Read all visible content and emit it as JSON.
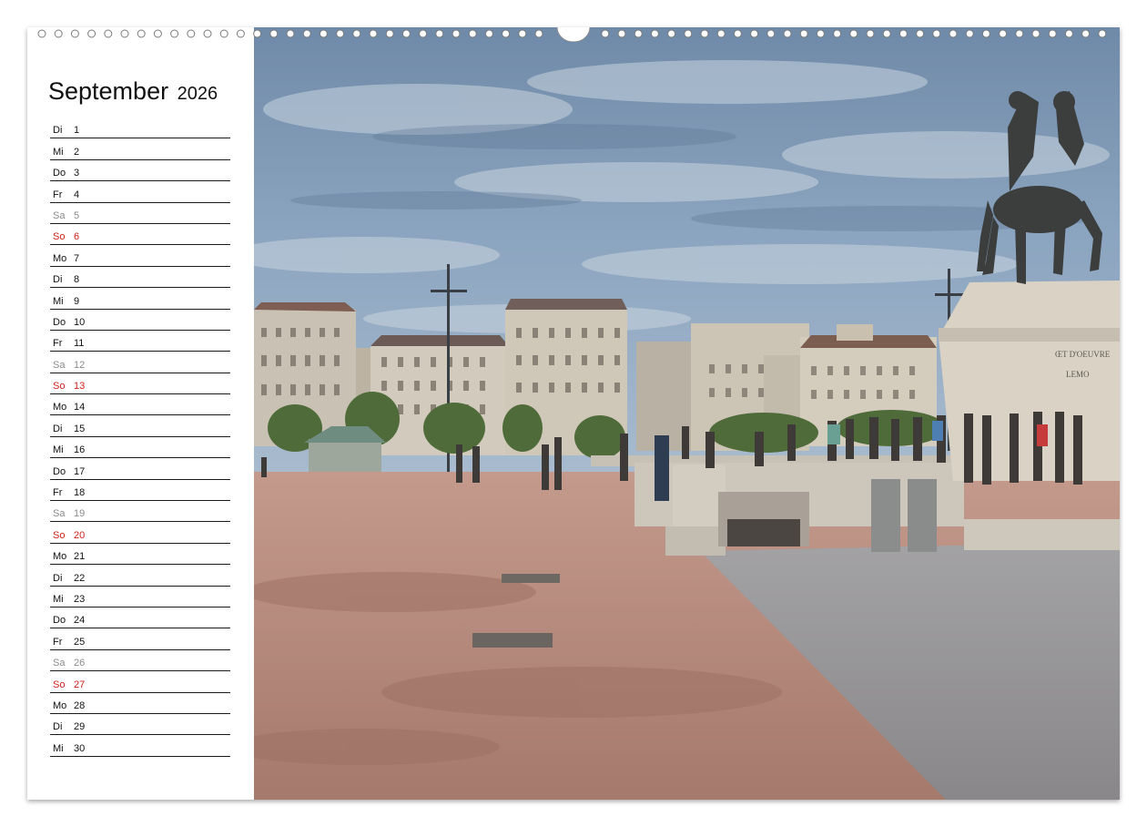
{
  "calendar": {
    "month": "September",
    "year": "2026",
    "days": [
      {
        "wd": "Di",
        "d": "1",
        "type": "weekday"
      },
      {
        "wd": "Mi",
        "d": "2",
        "type": "weekday"
      },
      {
        "wd": "Do",
        "d": "3",
        "type": "weekday"
      },
      {
        "wd": "Fr",
        "d": "4",
        "type": "weekday"
      },
      {
        "wd": "Sa",
        "d": "5",
        "type": "saturday"
      },
      {
        "wd": "So",
        "d": "6",
        "type": "sunday"
      },
      {
        "wd": "Mo",
        "d": "7",
        "type": "weekday"
      },
      {
        "wd": "Di",
        "d": "8",
        "type": "weekday"
      },
      {
        "wd": "Mi",
        "d": "9",
        "type": "weekday"
      },
      {
        "wd": "Do",
        "d": "10",
        "type": "weekday"
      },
      {
        "wd": "Fr",
        "d": "11",
        "type": "weekday"
      },
      {
        "wd": "Sa",
        "d": "12",
        "type": "saturday"
      },
      {
        "wd": "So",
        "d": "13",
        "type": "sunday"
      },
      {
        "wd": "Mo",
        "d": "14",
        "type": "weekday"
      },
      {
        "wd": "Di",
        "d": "15",
        "type": "weekday"
      },
      {
        "wd": "Mi",
        "d": "16",
        "type": "weekday"
      },
      {
        "wd": "Do",
        "d": "17",
        "type": "weekday"
      },
      {
        "wd": "Fr",
        "d": "18",
        "type": "weekday"
      },
      {
        "wd": "Sa",
        "d": "19",
        "type": "saturday"
      },
      {
        "wd": "So",
        "d": "20",
        "type": "sunday"
      },
      {
        "wd": "Mo",
        "d": "21",
        "type": "weekday"
      },
      {
        "wd": "Di",
        "d": "22",
        "type": "weekday"
      },
      {
        "wd": "Mi",
        "d": "23",
        "type": "weekday"
      },
      {
        "wd": "Do",
        "d": "24",
        "type": "weekday"
      },
      {
        "wd": "Fr",
        "d": "25",
        "type": "weekday"
      },
      {
        "wd": "Sa",
        "d": "26",
        "type": "saturday"
      },
      {
        "wd": "So",
        "d": "27",
        "type": "sunday"
      },
      {
        "wd": "Mo",
        "d": "28",
        "type": "weekday"
      },
      {
        "wd": "Di",
        "d": "29",
        "type": "weekday"
      },
      {
        "wd": "Mi",
        "d": "30",
        "type": "weekday"
      }
    ]
  },
  "colors": {
    "sunday": "#d0201a",
    "saturday": "#8a8a8a",
    "weekday": "#111111",
    "sky": "#7f9bb8",
    "ground": "#b48a7e"
  },
  "photo": {
    "statue_inscription_line1": "ŒT D'OEUVRE",
    "statue_inscription_line2": "LEMO"
  }
}
